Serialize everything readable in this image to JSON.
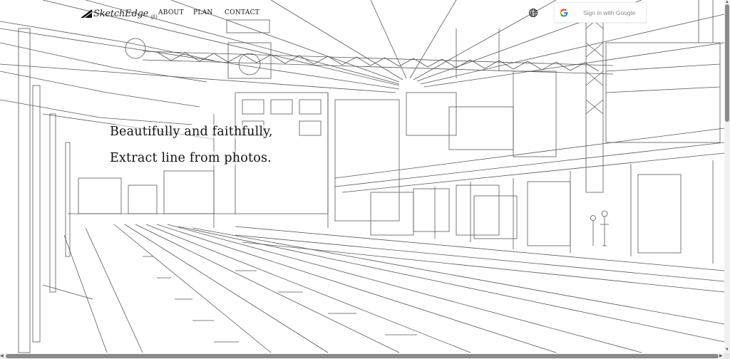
{
  "brand": {
    "name": "SketchEdge",
    "suffix": "(β)"
  },
  "nav": {
    "items": [
      {
        "label": "ABOUT"
      },
      {
        "label": "PLAN"
      },
      {
        "label": "CONTACT"
      }
    ]
  },
  "language_icon": "globe-icon",
  "signin": {
    "label": "Sign in with Google",
    "icon": "google-g-icon"
  },
  "hero": {
    "line1": "Beautifully and faithfully,",
    "line2": "Extract line from photos."
  },
  "background": {
    "subject": "line-art sketch of a train station platform with overhead wires"
  },
  "colors": {
    "line": "#3a3a3a",
    "page": "#ffffff",
    "scrollbar_thumb": "#8a8a8a"
  }
}
